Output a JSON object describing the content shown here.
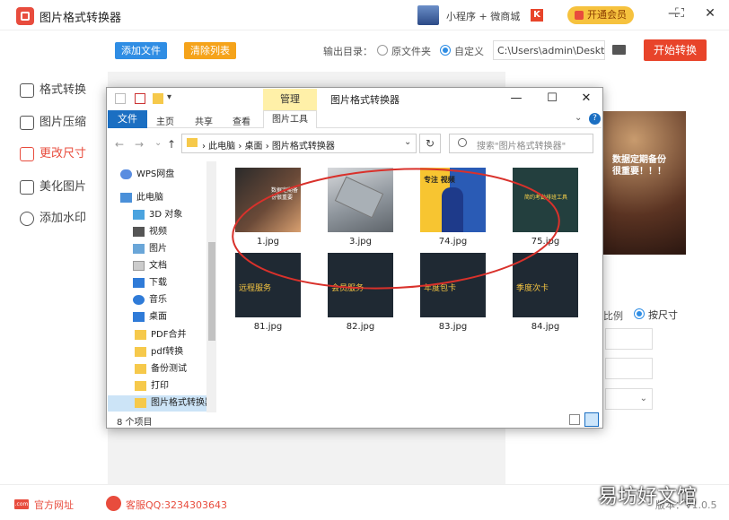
{
  "app": {
    "title": "图片格式转换器"
  },
  "topbar": {
    "mini_program_label": "小程序 + 微商城",
    "k_logo": "K",
    "vip_label": "开通会员",
    "minimize": "—",
    "maximize": "⛶",
    "close": "✕"
  },
  "toolbar": {
    "add_files": "添加文件",
    "clear_list": "清除列表",
    "output_dir_label": "输出目录：",
    "radio_original": "原文件夹",
    "radio_custom": "自定义",
    "path_value": "C:\\Users\\admin\\Deskto",
    "start": "开始转换"
  },
  "nav": [
    {
      "label": "格式转换"
    },
    {
      "label": "图片压缩"
    },
    {
      "label": "更改尺寸"
    },
    {
      "label": "美化图片"
    },
    {
      "label": "添加水印"
    }
  ],
  "right": {
    "preview_text_line1": "数据定期备份",
    "preview_text_line2": "很重要！！！",
    "ratio_label": "比例",
    "size_label": "按尺寸"
  },
  "footer": {
    "site_icon": ".com",
    "site_label": "官方网址",
    "qq_label": "客服QQ:3234303643",
    "version": "版本：V1.0.5"
  },
  "watermark": "易坊好文馆",
  "explorer": {
    "qa_arrow": "▾",
    "tool_tab": "管理",
    "window_title": "图片格式转换器",
    "minimize": "—",
    "maximize": "☐",
    "close": "✕",
    "tabs": {
      "file": "文件",
      "home": "主页",
      "share": "共享",
      "view": "查看",
      "picture_tools": "图片工具"
    },
    "ribbon_chevron": "⌄",
    "help": "?",
    "nav": {
      "back": "←",
      "forward": "→",
      "dropdown": "⌄",
      "up": "↑"
    },
    "address": "› 此电脑 › 桌面 › 图片格式转换器",
    "address_dropdown": "⌄",
    "refresh": "↻",
    "search_placeholder": "搜索\"图片格式转换器\"",
    "tree": [
      {
        "label": "WPS网盘",
        "icon": "cloud-icon"
      },
      {
        "label": "此电脑",
        "icon": "pc-icon"
      },
      {
        "label": "3D 对象",
        "icon": "cube-icon"
      },
      {
        "label": "视频",
        "icon": "video-icon"
      },
      {
        "label": "图片",
        "icon": "picture-icon"
      },
      {
        "label": "文档",
        "icon": "document-icon"
      },
      {
        "label": "下载",
        "icon": "download-icon"
      },
      {
        "label": "音乐",
        "icon": "music-icon"
      },
      {
        "label": "桌面",
        "icon": "desktop-icon"
      },
      {
        "label": "PDF合并",
        "icon": "folder-icon"
      },
      {
        "label": "pdf转换",
        "icon": "folder-icon"
      },
      {
        "label": "备份测试",
        "icon": "folder-icon"
      },
      {
        "label": "打印",
        "icon": "folder-icon"
      },
      {
        "label": "图片格式转换器",
        "icon": "folder-icon"
      }
    ],
    "files": [
      {
        "name": "1.jpg",
        "thumb_text": "数据定期备份很重要"
      },
      {
        "name": "3.jpg",
        "thumb_text": ""
      },
      {
        "name": "74.jpg",
        "thumb_text": "专注 视频"
      },
      {
        "name": "75.jpg",
        "thumb_text": "简约考勤排班工具"
      },
      {
        "name": "81.jpg",
        "thumb_text": "远程服务"
      },
      {
        "name": "82.jpg",
        "thumb_text": "会员服务"
      },
      {
        "name": "83.jpg",
        "thumb_text": "年度包卡"
      },
      {
        "name": "84.jpg",
        "thumb_text": "季度次卡"
      }
    ],
    "status": "8 个项目"
  },
  "colors": {
    "accent_red": "#e84c3d",
    "primary_blue": "#2f8de4",
    "orange": "#f5a31a",
    "explorer_blue": "#1b6fc2",
    "annotation_red": "#d9312b"
  }
}
